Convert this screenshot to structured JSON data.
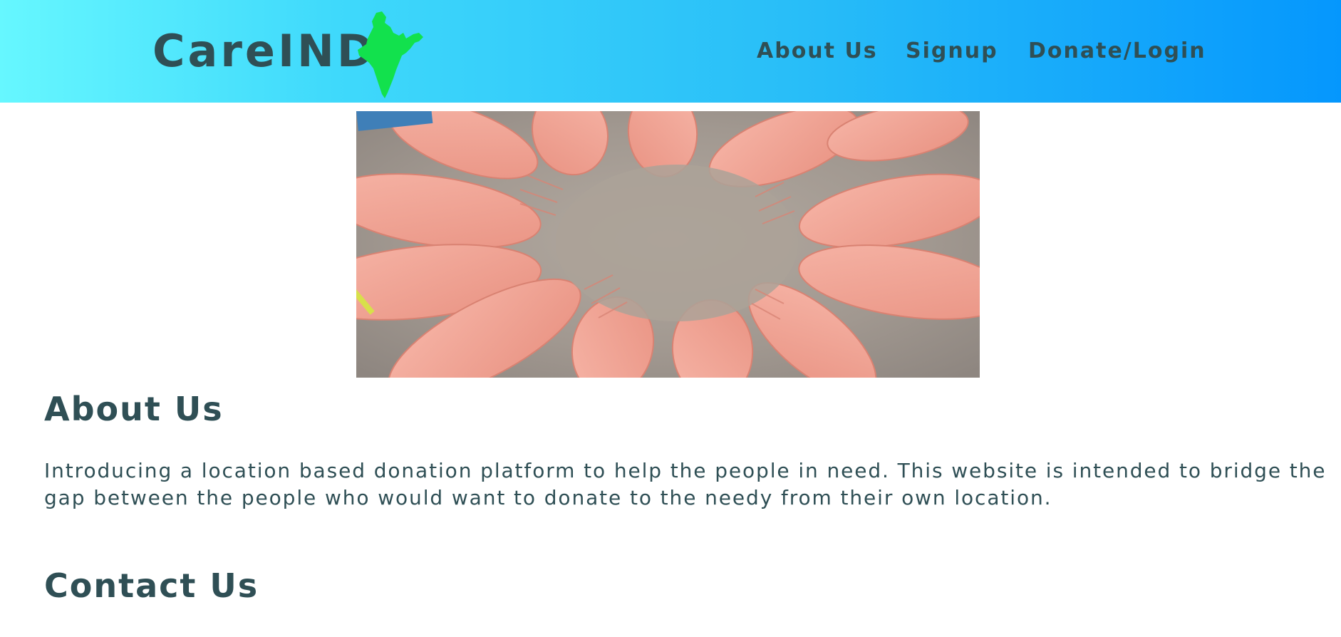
{
  "header": {
    "brand": "CareIND",
    "nav": {
      "about": "About Us",
      "signup": "Signup",
      "donate_login": "Donate/Login"
    }
  },
  "main": {
    "about_title": "About Us",
    "about_text": "Introducing a location based donation platform to help the people in need. This website is intended to bridge the gap between the people who would want to donate to the needy from their own location.",
    "contact_title": "Contact Us"
  },
  "colors": {
    "gradient_start": "#66f7ff",
    "gradient_end": "#0597fd",
    "text": "#2f4f55",
    "map_green": "#12e14d"
  },
  "icons": {
    "logo_map": "india-map-icon"
  }
}
